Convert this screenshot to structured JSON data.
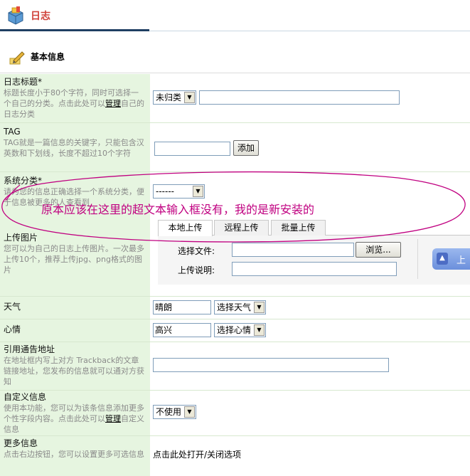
{
  "app": {
    "title": "日志"
  },
  "section": {
    "title": "基本信息"
  },
  "fields": {
    "title": {
      "label": "日志标题*",
      "desc_before": "标题长度小于80个字符，同时可选择一个自己的分类。点击此处可以",
      "desc_link": "管理",
      "desc_after": "自己的日志分类",
      "category_value": "未归类",
      "input_value": ""
    },
    "tag": {
      "label": "TAG",
      "desc": "TAG就是一篇信息的关键字，只能包含汉英数和下划线，长度不超过10个字符",
      "input_value": "",
      "add_button": "添加"
    },
    "system_category": {
      "label": "系统分类*",
      "desc": "请为您的信息正确选择一个系统分类，便于信息被更多的人查看到",
      "value": "------"
    },
    "upload": {
      "label": "上传图片",
      "desc": "您可以为自己的日志上传图片。一次最多上传10个，推荐上传jpg、png格式的图片",
      "tabs": [
        "本地上传",
        "远程上传",
        "批量上传"
      ],
      "file_label": "选择文件:",
      "browse_button": "浏览...",
      "desc_label": "上传说明:",
      "side_button": "上"
    },
    "weather": {
      "label": "天气",
      "value": "晴朗",
      "select": "选择天气"
    },
    "mood": {
      "label": "心情",
      "value": "高兴",
      "select": "选择心情"
    },
    "trackback": {
      "label": "引用通告地址",
      "desc": "在地址框内写上对方 Trackback的文章链接地址，您发布的信息就可以通对方获知",
      "input_value": ""
    },
    "custom": {
      "label": "自定义信息",
      "desc_before": "使用本功能，您可以为该条信息添加更多个性字段内容。点击此处可以",
      "desc_link": "管理",
      "desc_after": "自定义信息",
      "value": "不使用"
    },
    "more": {
      "label": "更多信息",
      "desc": "点击右边按钮，您可以设置更多可选信息",
      "toggle": "点击此处打开/关闭选项"
    }
  },
  "annotation": {
    "text": "原本应该在这里的超文本输入框没有，我的是新安装的"
  },
  "colors": {
    "left_column": "#e6f5e0",
    "annotation": "#c00080",
    "title": "#d0413a"
  }
}
